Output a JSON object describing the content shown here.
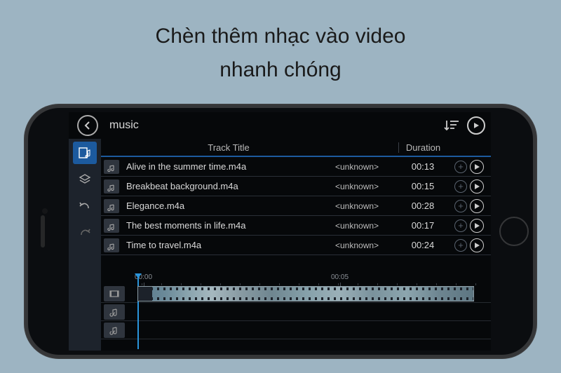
{
  "promo": {
    "line1": "Chèn thêm nhạc vào video",
    "line2": "nhanh chóng"
  },
  "topbar": {
    "title": "music"
  },
  "table": {
    "header_title": "Track Title",
    "header_duration": "Duration"
  },
  "tracks": [
    {
      "name": "Alive in the summer time.m4a",
      "meta": "<unknown>",
      "duration": "00:13"
    },
    {
      "name": "Breakbeat background.m4a",
      "meta": "<unknown>",
      "duration": "00:15"
    },
    {
      "name": "Elegance.m4a",
      "meta": "<unknown>",
      "duration": "00:28"
    },
    {
      "name": "The best moments in life.m4a",
      "meta": "<unknown>",
      "duration": "00:17"
    },
    {
      "name": "Time to travel.m4a",
      "meta": "<unknown>",
      "duration": "00:24"
    }
  ],
  "timeline": {
    "ticks": [
      "00:00",
      "00:05"
    ]
  }
}
